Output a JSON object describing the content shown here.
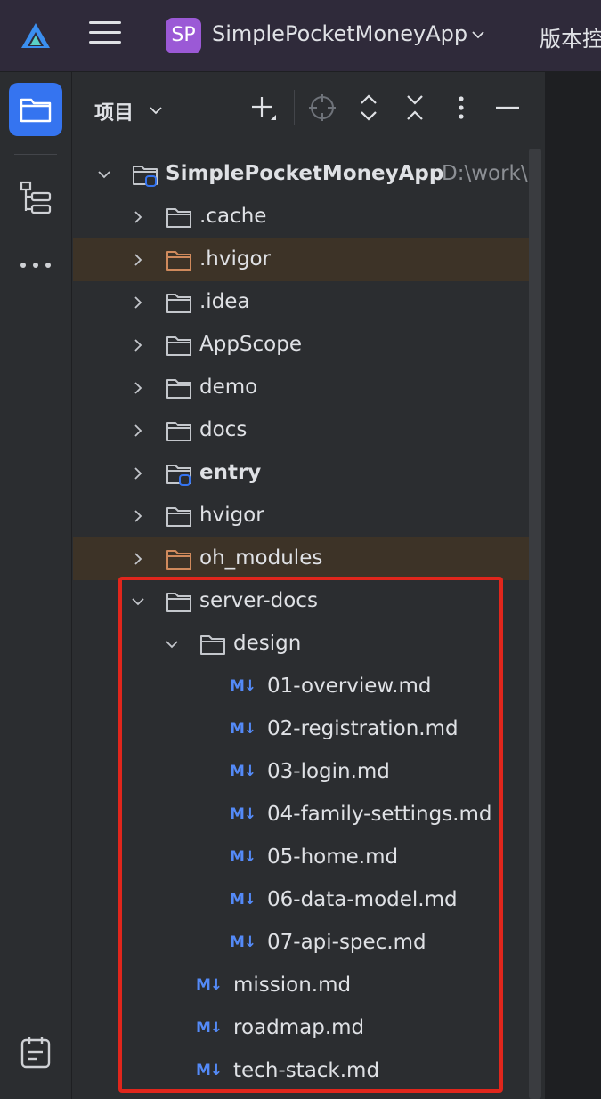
{
  "titlebar": {
    "project_badge": "SP",
    "project_name": "SimplePocketMoneyApp",
    "vcs_label": "版本控"
  },
  "panel": {
    "title": "项目"
  },
  "tree": [
    {
      "level": 0,
      "type": "project",
      "label": "SimplePocketMoneyApp",
      "path": "D:\\work\\S",
      "expanded": true,
      "bold": true
    },
    {
      "level": 1,
      "type": "folder",
      "label": ".cache",
      "expanded": false
    },
    {
      "level": 1,
      "type": "folder-orange",
      "label": ".hvigor",
      "expanded": false,
      "highlight": true
    },
    {
      "level": 1,
      "type": "folder",
      "label": ".idea",
      "expanded": false
    },
    {
      "level": 1,
      "type": "folder",
      "label": "AppScope",
      "expanded": false
    },
    {
      "level": 1,
      "type": "folder",
      "label": "demo",
      "expanded": false
    },
    {
      "level": 1,
      "type": "folder",
      "label": "docs",
      "expanded": false
    },
    {
      "level": 1,
      "type": "module",
      "label": "entry",
      "expanded": false,
      "bold": true
    },
    {
      "level": 1,
      "type": "folder",
      "label": "hvigor",
      "expanded": false
    },
    {
      "level": 1,
      "type": "folder-orange",
      "label": "oh_modules",
      "expanded": false,
      "highlight": true
    },
    {
      "level": 1,
      "type": "folder",
      "label": "server-docs",
      "expanded": true
    },
    {
      "level": 2,
      "type": "folder",
      "label": "design",
      "expanded": true
    },
    {
      "level": 3,
      "type": "md",
      "label": "01-overview.md"
    },
    {
      "level": 3,
      "type": "md",
      "label": "02-registration.md"
    },
    {
      "level": 3,
      "type": "md",
      "label": "03-login.md"
    },
    {
      "level": 3,
      "type": "md",
      "label": "04-family-settings.md"
    },
    {
      "level": 3,
      "type": "md",
      "label": "05-home.md"
    },
    {
      "level": 3,
      "type": "md",
      "label": "06-data-model.md"
    },
    {
      "level": 3,
      "type": "md",
      "label": "07-api-spec.md"
    },
    {
      "level": 2,
      "type": "md",
      "label": "mission.md"
    },
    {
      "level": 2,
      "type": "md",
      "label": "roadmap.md"
    },
    {
      "level": 2,
      "type": "md",
      "label": "tech-stack.md"
    }
  ],
  "markdown_badge": "M↓",
  "colors": {
    "accent": "#3574f0",
    "badge": "#9b59d6",
    "markdown": "#548af7",
    "excluded_folder": "#d08a5c",
    "highlight_row": "#3d3327",
    "annotation_box": "#e0261c"
  },
  "icons": {
    "app_logo": "deveco-logo-icon",
    "menu": "hamburger-menu-icon",
    "project_view": "folder-icon",
    "structure": "structure-icon",
    "more": "more-horizontal-icon",
    "bottom": "notes-icon"
  }
}
